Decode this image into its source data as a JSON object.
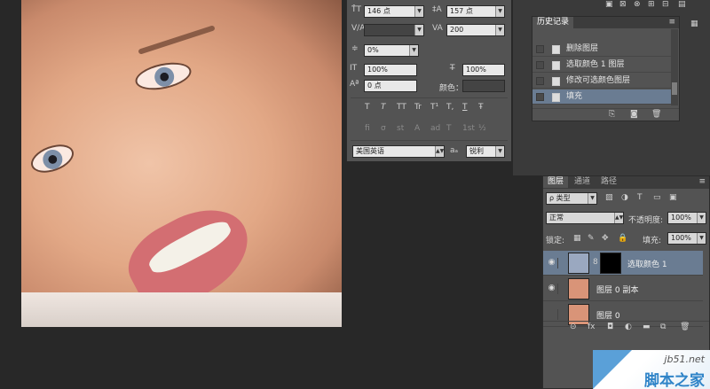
{
  "character": {
    "font_size": "146 点",
    "leading": "157 点",
    "kerning": "",
    "tracking": "200",
    "scale_pct": "0%",
    "vertical_scale": "100%",
    "horizontal_scale": "100%",
    "baseline_shift": "0 点",
    "color_label": "颜色：",
    "style_buttons": [
      "T",
      "T",
      "TT",
      "Tr",
      "T¹",
      "T,",
      "T",
      "Ŧ"
    ],
    "opentype_buttons": [
      "fi",
      "σ",
      "st",
      "A",
      "ad",
      "T",
      "1st",
      "½"
    ],
    "language": "美国英语",
    "aa_label": "aₐ",
    "aa_mode": "锐利"
  },
  "history": {
    "tab": "历史记录",
    "items": [
      {
        "label": "删除图层",
        "selected": false
      },
      {
        "label": "选取颜色 1 图层",
        "selected": false
      },
      {
        "label": "修改可选颜色图层",
        "selected": false
      },
      {
        "label": "填充",
        "selected": true
      }
    ]
  },
  "layers": {
    "tabs": [
      "图层",
      "通道",
      "路径"
    ],
    "filter_kind": "ρ 类型",
    "blend_mode": "正常",
    "opacity_label": "不透明度:",
    "opacity": "100%",
    "lock_label": "锁定:",
    "fill_label": "填充:",
    "fill": "100%",
    "items": [
      {
        "label": "选取颜色 1",
        "selected": true,
        "thumb": "#000000"
      },
      {
        "label": "图层 0 副本",
        "selected": false,
        "thumb": "#d99478"
      },
      {
        "label": "图层 0",
        "selected": false,
        "thumb": "#d99478"
      }
    ],
    "footer_icons": [
      "link-icon",
      "fx-icon",
      "mask-icon",
      "adjustment-icon",
      "group-icon",
      "new-layer-icon",
      "trash-icon"
    ]
  },
  "watermark": {
    "url": "jb51.net",
    "name": "脚本之家"
  }
}
